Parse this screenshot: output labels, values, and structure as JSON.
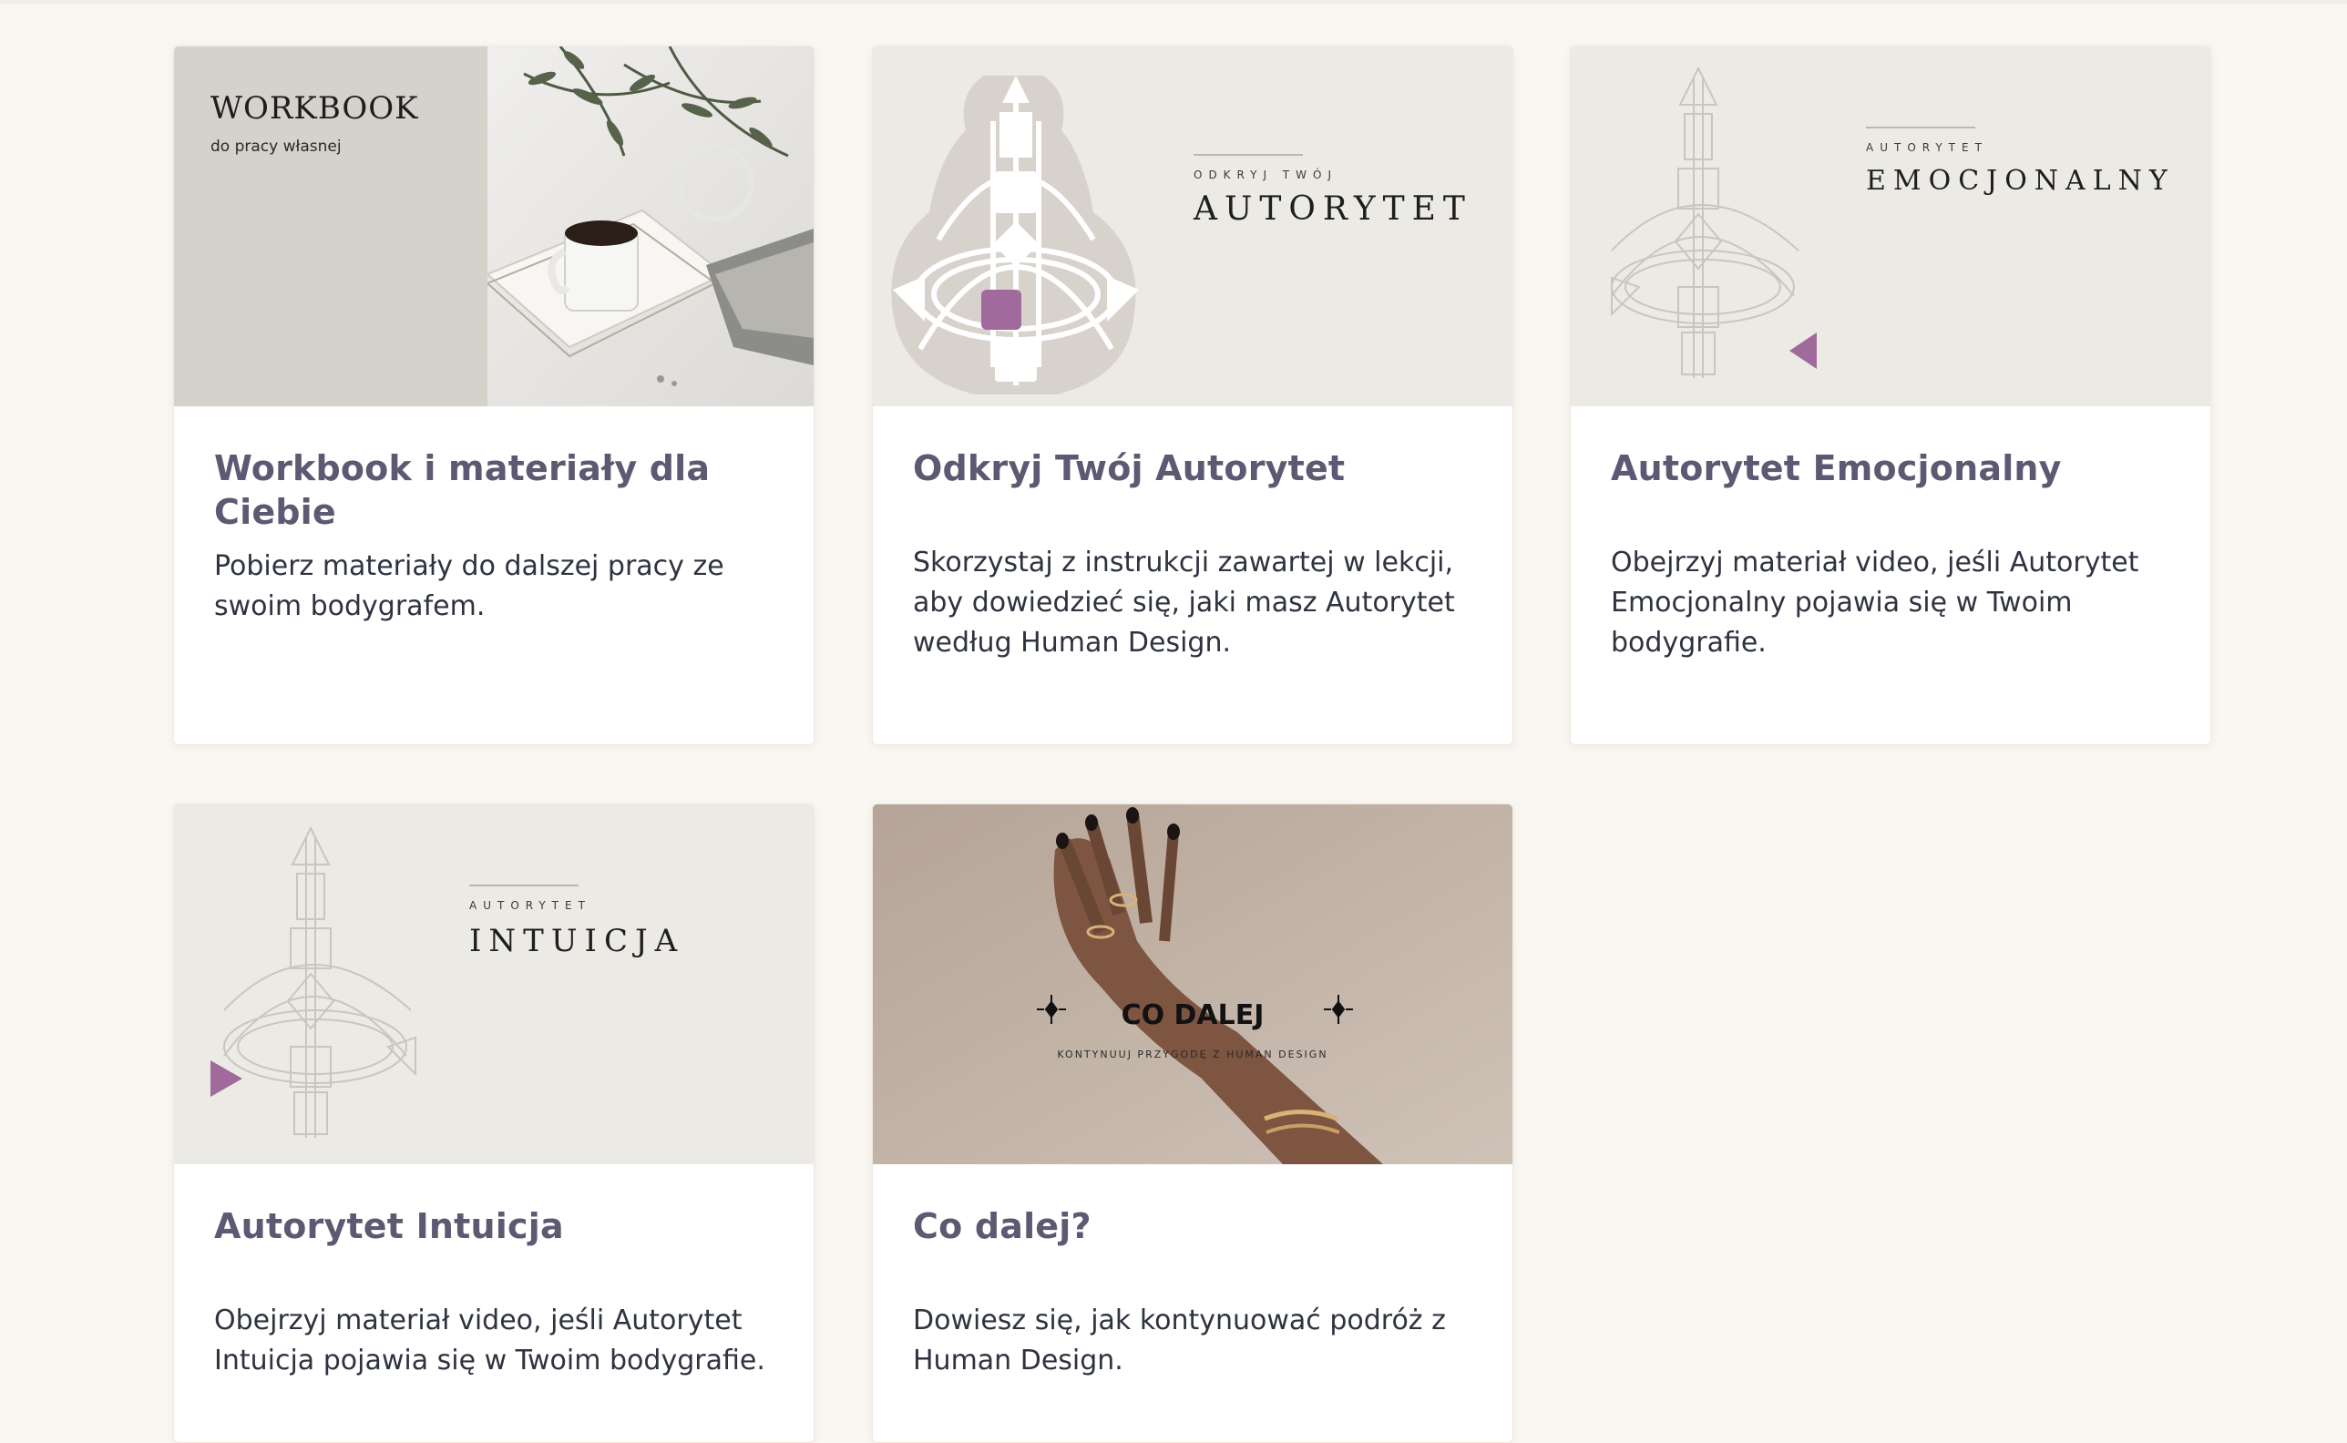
{
  "colors": {
    "page_bg": "#faf7f2",
    "title": "#5c5a72",
    "text": "#2f3340",
    "accent_purple": "#9b5f95"
  },
  "cards": [
    {
      "title": "Workbook i materiały dla Ciebie",
      "description": "Pobierz materiały do dalszej pracy ze swoim bodygrafem.",
      "thumb": {
        "heading": "WORKBOOK",
        "subheading": "do pracy własnej",
        "icon": "coffee-photo"
      }
    },
    {
      "title": "Odkryj Twój Autorytet",
      "description": "Skorzystaj z instrukcji zawartej w lekcji, aby dowiedzieć się, jaki masz Autorytet według Human Design.",
      "thumb": {
        "kicker": "ODKRYJ TWÓJ",
        "heading": "AUTORYTET",
        "icon": "bodygraph-icon"
      }
    },
    {
      "title": "Autorytet Emocjonalny",
      "description": "Obejrzyj materiał video, jeśli Autorytet Emocjonalny pojawia się w Twoim bodygrafie.",
      "thumb": {
        "kicker": "AUTORYTET",
        "heading": "EMOCJONALNY",
        "icon": "bodygraph-icon"
      }
    },
    {
      "title": "Autorytet Intuicja",
      "description": "Obejrzyj materiał video, jeśli Autorytet Intuicja pojawia się w Twoim bodygrafie.",
      "thumb": {
        "kicker": "AUTORYTET",
        "heading": "INTUICJA",
        "icon": "bodygraph-icon"
      }
    },
    {
      "title": "Co dalej?",
      "description": "Dowiesz się, jak kontynuować podróż z Human Design.",
      "thumb": {
        "heading": "CO DALEJ",
        "subheading": "KONTYNUUJ PRZYGODĘ Z HUMAN DESIGN",
        "icon": "hand-photo"
      }
    }
  ]
}
